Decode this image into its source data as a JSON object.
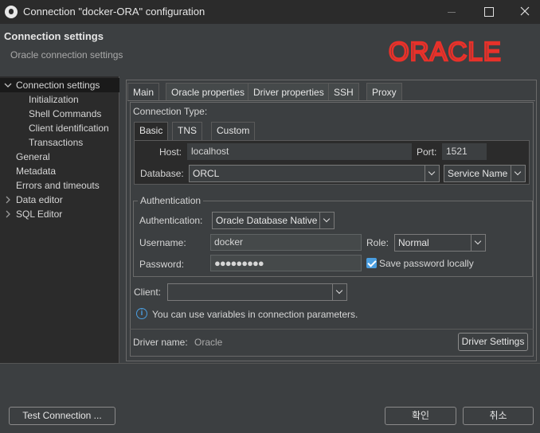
{
  "window": {
    "title": "Connection \"docker-ORA\" configuration"
  },
  "header": {
    "title": "Connection settings",
    "subtitle": "Oracle connection settings",
    "logo_text": "ORACLE",
    "logo_color": "#e8312a"
  },
  "tree": {
    "items": [
      {
        "label": "Connection settings",
        "expanded": true,
        "selected": true
      },
      {
        "label": "Initialization"
      },
      {
        "label": "Shell Commands"
      },
      {
        "label": "Client identification"
      },
      {
        "label": "Transactions"
      },
      {
        "label": "General"
      },
      {
        "label": "Metadata"
      },
      {
        "label": "Errors and timeouts"
      },
      {
        "label": "Data editor",
        "expandable": true
      },
      {
        "label": "SQL Editor",
        "expandable": true
      }
    ]
  },
  "tabs": [
    "Main",
    "Oracle properties",
    "Driver properties",
    "SSH",
    "Proxy"
  ],
  "connection_type": {
    "label": "Connection Type:",
    "tabs": [
      "Basic",
      "TNS",
      "Custom"
    ],
    "host_label": "Host:",
    "host_value": "localhost",
    "port_label": "Port:",
    "port_value": "1521",
    "database_label": "Database:",
    "database_value": "ORCL",
    "service_value": "Service Name"
  },
  "auth": {
    "group_label": "Authentication",
    "auth_label": "Authentication:",
    "auth_value": "Oracle Database Native",
    "username_label": "Username:",
    "username_value": "docker",
    "role_label": "Role:",
    "role_value": "Normal",
    "password_label": "Password:",
    "password_value": "●●●●●●●●●",
    "save_password_label": "Save password locally",
    "save_password_checked": true
  },
  "client": {
    "label": "Client:",
    "value": ""
  },
  "info_text": "You can use variables in connection parameters.",
  "driver": {
    "label": "Driver name:",
    "value": "Oracle",
    "settings_button": "Driver Settings"
  },
  "footer": {
    "test_button": "Test Connection ...",
    "ok_button": "확인",
    "cancel_button": "취소"
  }
}
